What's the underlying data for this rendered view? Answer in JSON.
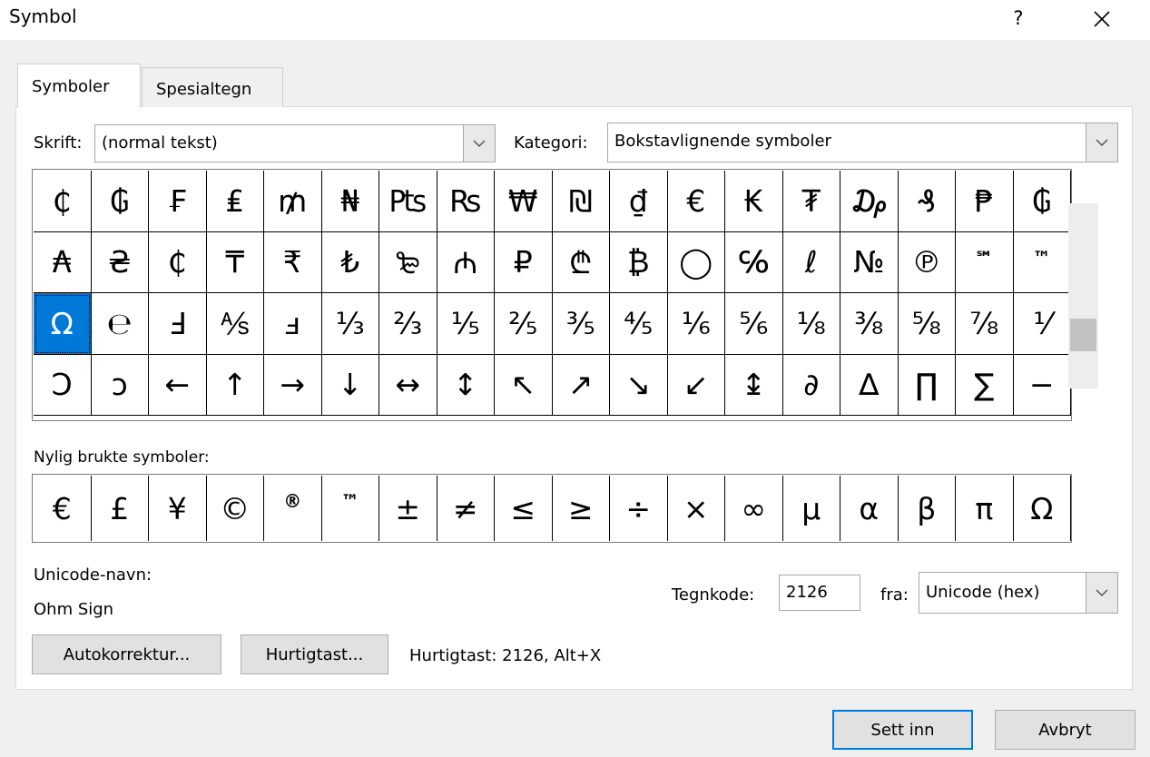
{
  "window": {
    "title": "Symbol",
    "help_label": "?"
  },
  "tabs": [
    {
      "label": "Symboler",
      "active": true
    },
    {
      "label": "Spesialtegn",
      "active": false
    }
  ],
  "font": {
    "label": "Skrift:",
    "value": "(normal tekst)"
  },
  "category": {
    "label": "Kategori:",
    "value": "Bokstavlignende symboler"
  },
  "symbols": [
    [
      "₵",
      "₲",
      "₣",
      "₤",
      "₥",
      "₦",
      "₧",
      "₨",
      "₩",
      "₪",
      "₫",
      "€",
      "₭",
      "₮",
      "₯",
      "₰",
      "₱",
      "₲"
    ],
    [
      "₳",
      "₴",
      "₵",
      "₸",
      "₹",
      "₺",
      "₻",
      "₼",
      "₽",
      "₾",
      "₿",
      "◯",
      "℅",
      "ℓ",
      "№",
      "℗",
      "℠",
      "™"
    ],
    [
      "Ω",
      "℮",
      "Ⅎ",
      "⅍",
      "ⅎ",
      "⅓",
      "⅔",
      "⅕",
      "⅖",
      "⅗",
      "⅘",
      "⅙",
      "⅚",
      "⅛",
      "⅜",
      "⅝",
      "⅞",
      "⅟"
    ],
    [
      "Ↄ",
      "ↄ",
      "←",
      "↑",
      "→",
      "↓",
      "↔",
      "↕",
      "↖",
      "↗",
      "↘",
      "↙",
      "↨",
      "∂",
      "∆",
      "∏",
      "∑",
      "−"
    ]
  ],
  "selected_symbol": "Ω",
  "recent": {
    "label": "Nylig brukte symboler:",
    "items": [
      "€",
      "£",
      "¥",
      "©",
      "®",
      "™",
      "±",
      "≠",
      "≤",
      "≥",
      "÷",
      "×",
      "∞",
      "µ",
      "α",
      "β",
      "π",
      "Ω"
    ]
  },
  "unicode_name": {
    "label": "Unicode-navn:",
    "value": "Ohm Sign"
  },
  "char_code": {
    "label": "Tegnkode:",
    "value": "2126"
  },
  "from": {
    "label": "fra:",
    "value": "Unicode (hex)"
  },
  "buttons": {
    "autocorrect": "Autokorrektur...",
    "shortcut_key": "Hurtigtast...",
    "insert": "Sett inn",
    "cancel": "Avbryt"
  },
  "shortcut_text": "Hurtigtast: 2126, Alt+X",
  "colors": {
    "selection": "#0078d7",
    "dialog_bg": "#f0f0f0"
  }
}
